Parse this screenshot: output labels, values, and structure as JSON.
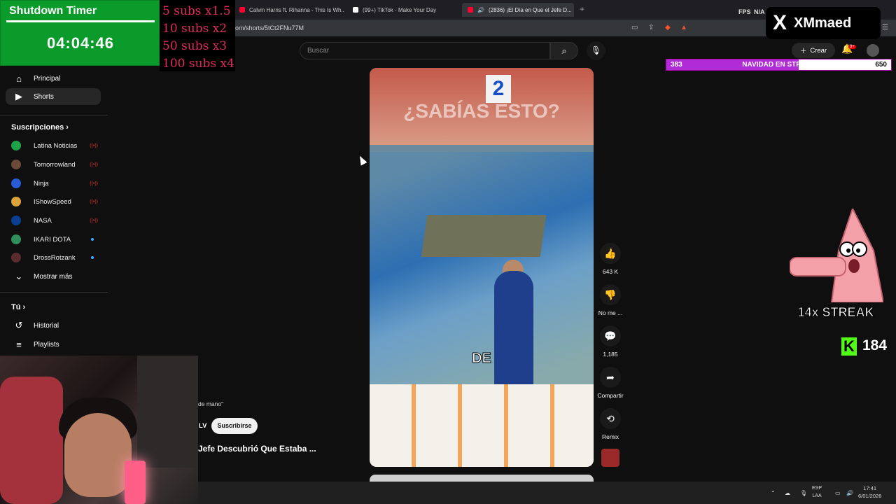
{
  "browser": {
    "tabs": [
      {
        "title": "Calvin Harris ft. Rihanna - This Is Wh...",
        "color": "#ff0033"
      },
      {
        "title": "(99+) TikTok - Make Your Day",
        "color": "#222222"
      },
      {
        "title": "(2836) ¡El Día en Que el Jefe D...",
        "color": "#ff0033"
      }
    ],
    "url": "om/shorts/5tCt2FNu77M",
    "fps_label": "FPS",
    "fps_value": "N/A",
    "right_value": "N/A"
  },
  "timer": {
    "title": "Shutdown Timer",
    "value": "04:04:46"
  },
  "subs_multipliers": [
    "5 subs x1.5",
    "10 subs x2",
    "50 subs x3",
    "100 subs x4"
  ],
  "sidebar": {
    "main": [
      {
        "label": "Principal",
        "icon": "home-icon"
      },
      {
        "label": "Shorts",
        "icon": "shorts-icon"
      }
    ],
    "subscriptions_title": "Suscripciones",
    "subscriptions": [
      {
        "name": "Latina Noticias",
        "color": "#1fa34a",
        "status": "live"
      },
      {
        "name": "Tomorrowland",
        "color": "#6b4a3a",
        "status": "live"
      },
      {
        "name": "Ninja",
        "color": "#2a5bd7",
        "status": "live"
      },
      {
        "name": "IShowSpeed",
        "color": "#d9a23a",
        "status": "live"
      },
      {
        "name": "NASA",
        "color": "#0b3d91",
        "status": "live"
      },
      {
        "name": "IKARI DOTA",
        "color": "#2f8f5a",
        "status": "new"
      },
      {
        "name": "DrossRotzank",
        "color": "#5a2d2d",
        "status": "new"
      }
    ],
    "show_more": "Mostrar más",
    "you_title": "Tú",
    "you_items": [
      {
        "label": "Historial",
        "icon": "history-icon"
      },
      {
        "label": "Playlists",
        "icon": "playlists-icon"
      }
    ]
  },
  "header": {
    "search_placeholder": "Buscar",
    "create_label": "Crear",
    "notif_badge": "9+"
  },
  "brand": {
    "x_logo": "X",
    "name": "XMmaed"
  },
  "goal": {
    "left": "383",
    "title": "NAVIDAD EN STREAM",
    "right": "650",
    "progress": 0.589
  },
  "video": {
    "overlay_text": "¿SABÍAS ESTO?",
    "sign_number": "2",
    "caption": "DE",
    "channel_partial": "LV",
    "desc_partial": "de mano\"",
    "subscribe_label": "Suscribirse",
    "title": "Jefe Descubrió Que Estaba ..."
  },
  "actions": {
    "likes": "643 K",
    "dislike": "No me ...",
    "comments": "1,185",
    "share": "Compartir",
    "remix": "Remix"
  },
  "overlays": {
    "streak": "14x STREAK",
    "kick_count": "184",
    "kick_letter": "K"
  },
  "taskbar": {
    "lang_top": "ESP",
    "lang_bottom": "LAA",
    "time": "17:41",
    "date": "6/01/2026"
  }
}
